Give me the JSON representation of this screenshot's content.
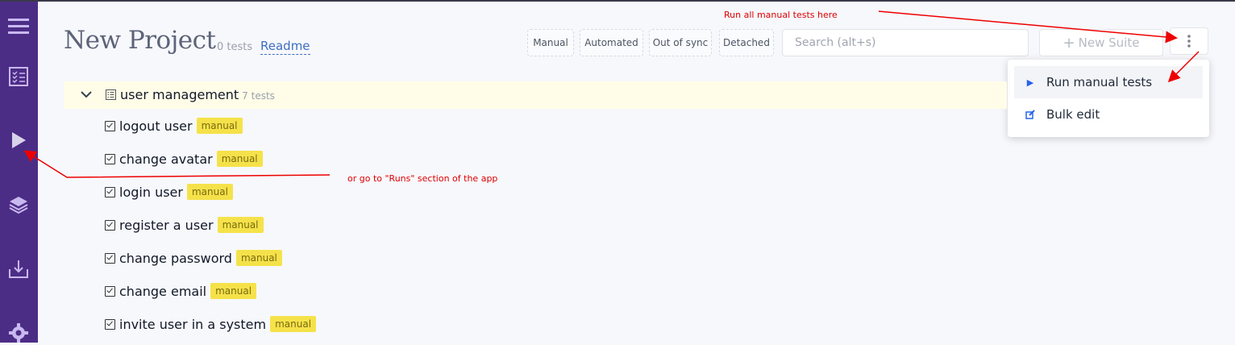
{
  "header": {
    "title": "New Project",
    "test_count": "0 tests",
    "readme_label": "Readme",
    "filters": [
      "Manual",
      "Automated",
      "Out of sync",
      "Detached"
    ],
    "search_placeholder": "Search (alt+s)",
    "new_suite_label": "New Suite"
  },
  "dropdown": {
    "items": [
      {
        "label": "Run manual tests",
        "icon": "play-icon"
      },
      {
        "label": "Bulk edit",
        "icon": "edit-icon"
      }
    ]
  },
  "suite": {
    "name": "user management",
    "count": "7 tests",
    "tests": [
      {
        "name": "logout user",
        "tag": "manual"
      },
      {
        "name": "change avatar",
        "tag": "manual"
      },
      {
        "name": "login user",
        "tag": "manual"
      },
      {
        "name": "register a user",
        "tag": "manual"
      },
      {
        "name": "change password",
        "tag": "manual"
      },
      {
        "name": "change email",
        "tag": "manual"
      },
      {
        "name": "invite user in a system",
        "tag": "manual"
      }
    ]
  },
  "annotations": {
    "top": "Run all manual tests here",
    "middle": "or go to \"Runs\" section of the app"
  },
  "sidebar": {
    "icons": [
      "menu-icon",
      "checklist-icon",
      "play-icon",
      "layers-icon",
      "download-icon",
      "gear-icon"
    ]
  },
  "colors": {
    "sidebar": "#4c2d86",
    "tag": "#f5e24a",
    "suite_row": "#fffde8",
    "link": "#3d6fbf",
    "annotation": "#dd0000"
  }
}
